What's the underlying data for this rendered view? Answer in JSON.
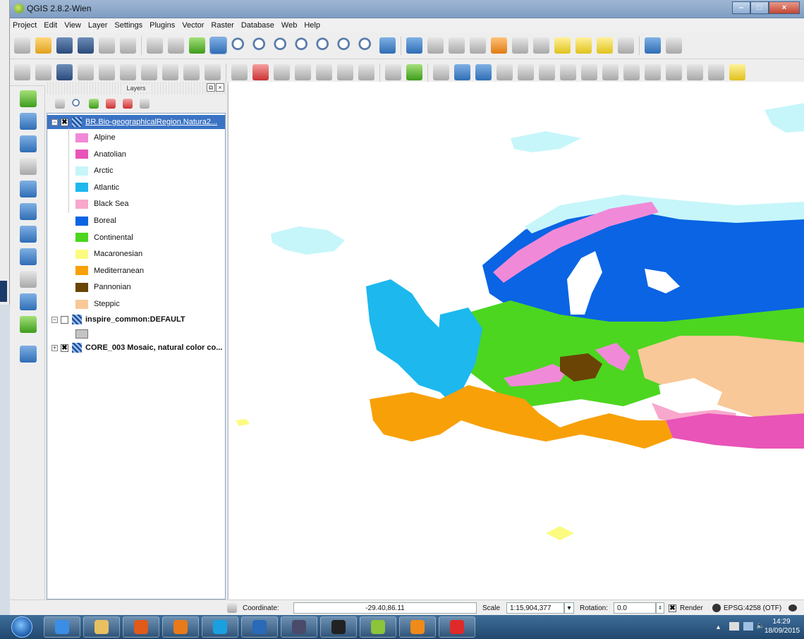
{
  "window": {
    "title": "QGIS 2.8.2-Wien"
  },
  "menu": [
    "Project",
    "Edit",
    "View",
    "Layer",
    "Settings",
    "Plugins",
    "Vector",
    "Raster",
    "Database",
    "Web",
    "Help"
  ],
  "toolbar1_icons": [
    "new-project-icon",
    "open-project-icon",
    "save-project-icon",
    "save-as-icon",
    "new-print-composer-icon",
    "composer-manager-icon",
    "touch-zoom-icon",
    "pan-icon",
    "pan-to-selection-icon",
    "zoom-in-icon",
    "zoom-out-icon",
    "zoom-native-icon",
    "zoom-full-icon",
    "zoom-to-selection-icon",
    "zoom-to-layer-icon",
    "zoom-last-icon",
    "zoom-next-icon",
    "refresh-icon",
    "identify-icon",
    "action-icon",
    "select-icon",
    "deselect-icon",
    "field-calculator-icon",
    "attribute-table-icon",
    "measure-icon",
    "map-tips-icon",
    "new-bookmark-icon",
    "show-bookmarks-icon",
    "text-annotation-icon",
    "help-icon",
    "whats-this-icon"
  ],
  "toolbar2_icons": [
    "current-edits-icon",
    "toggle-editing-icon",
    "save-edits-icon",
    "add-feature-icon",
    "move-feature-icon",
    "node-tool-icon",
    "delete-selected-icon",
    "cut-features-icon",
    "copy-features-icon",
    "paste-features-icon",
    "label-icon",
    "pin-labels-icon",
    "show-hide-labels-icon",
    "move-label-icon",
    "rotate-label-icon",
    "change-label-icon",
    "label-tool-icon",
    "csw-icon",
    "plugin-icon",
    "digitize-icon",
    "undo-icon",
    "redo-icon",
    "simplify-icon",
    "add-ring-icon",
    "add-part-icon",
    "fill-ring-icon",
    "delete-ring-icon",
    "delete-part-icon",
    "reshape-icon",
    "offset-curve-icon",
    "split-features-icon",
    "split-parts-icon",
    "merge-features-icon",
    "python-icon"
  ],
  "layers_panel": {
    "title": "Layers",
    "layers": [
      {
        "name": "BR.Bio-geographicalRegion.Natura2...",
        "checked": "✖",
        "selected": true
      },
      {
        "name": "inspire_common:DEFAULT",
        "checked": "",
        "selected": false
      },
      {
        "name": "CORE_003 Mosaic, natural color co...",
        "checked": "✖",
        "selected": false
      }
    ],
    "legend": [
      {
        "label": "Alpine",
        "color": "#f08ad8"
      },
      {
        "label": "Anatolian",
        "color": "#e854b8"
      },
      {
        "label": "Arctic",
        "color": "#c6f6fa"
      },
      {
        "label": "Atlantic",
        "color": "#1cb8ee"
      },
      {
        "label": "Black Sea",
        "color": "#f8a8cc"
      },
      {
        "label": "Boreal",
        "color": "#0a64e4"
      },
      {
        "label": "Continental",
        "color": "#4cd620"
      },
      {
        "label": "Macaronesian",
        "color": "#fbfb80"
      },
      {
        "label": "Mediterranean",
        "color": "#f8a008"
      },
      {
        "label": "Pannonian",
        "color": "#6a4404"
      },
      {
        "label": "Steppic",
        "color": "#f8c898"
      }
    ],
    "default_swatch_color": "#c4c4c4"
  },
  "status": {
    "coordinate_label": "Coordinate:",
    "coordinate_value": "-29.40,86.11",
    "scale_label": "Scale",
    "scale_value": "1:15,904,377",
    "rotation_label": "Rotation:",
    "rotation_value": "0.0",
    "render_label": "Render",
    "render_checked": "✖",
    "crs": "EPSG:4258 (OTF)"
  },
  "taskbar": {
    "time": "14:29",
    "date": "18/09/2015",
    "apps": [
      "internet-explorer-icon",
      "file-explorer-icon",
      "office-icon",
      "firefox-icon",
      "skype-icon",
      "outlook-icon",
      "keepass-icon",
      "obs-icon",
      "qgis-icon",
      "vlc-icon",
      "paint-icon"
    ]
  }
}
